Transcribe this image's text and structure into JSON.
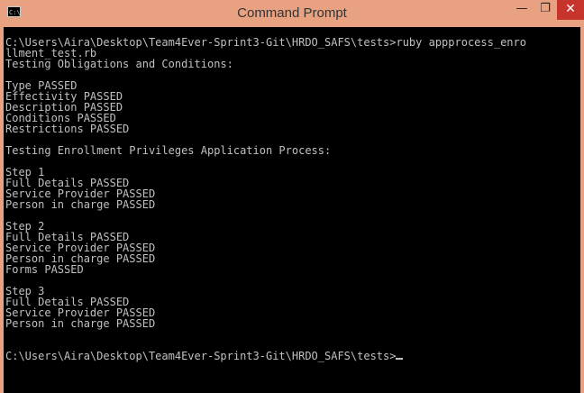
{
  "window": {
    "title": "Command Prompt",
    "icon": "cmd-icon",
    "controls": {
      "minimize": "—",
      "maximize": "❐",
      "close": "✕"
    }
  },
  "console": {
    "lines": [
      "C:\\Users\\Aira\\Desktop\\Team4Ever-Sprint3-Git\\HRDO_SAFS\\tests>ruby appprocess_enro",
      "llment_test.rb",
      "Testing Obligations and Conditions:",
      "",
      "Type PASSED",
      "Effectivity PASSED",
      "Description PASSED",
      "Conditions PASSED",
      "Restrictions PASSED",
      "",
      "Testing Enrollment Privileges Application Process:",
      "",
      "Step 1",
      "Full Details PASSED",
      "Service Provider PASSED",
      "Person in charge PASSED",
      "",
      "Step 2",
      "Full Details PASSED",
      "Service Provider PASSED",
      "Person in charge PASSED",
      "Forms PASSED",
      "",
      "Step 3",
      "Full Details PASSED",
      "Service Provider PASSED",
      "Person in charge PASSED",
      "",
      "",
      "C:\\Users\\Aira\\Desktop\\Team4Ever-Sprint3-Git\\HRDO_SAFS\\tests>"
    ]
  }
}
